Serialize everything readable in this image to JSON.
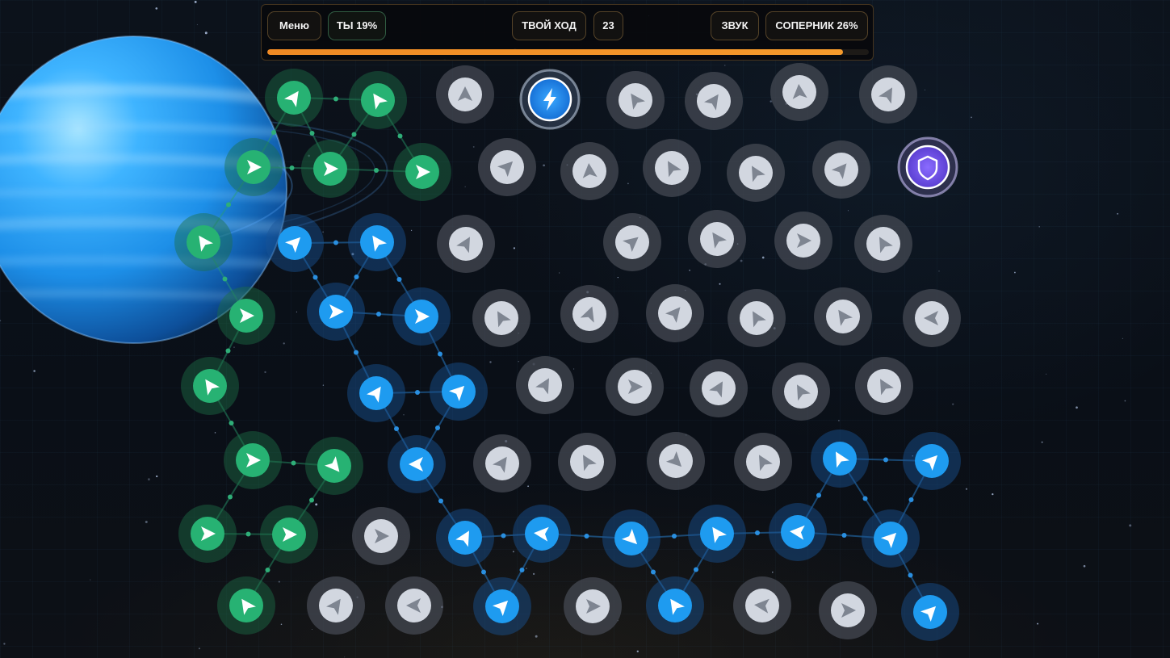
{
  "hud": {
    "menu_label": "Меню",
    "you_label": "ТЫ 19%",
    "you_share": 0.19,
    "turn_label": "ТВОЙ ХОД",
    "turn_counter": "23",
    "sound_label": "ЗВУК",
    "opponent_label": "СОПЕРНИК 26%",
    "opponent_share": 0.26,
    "progress": 0.957
  },
  "colors": {
    "player_green": "#27b273",
    "ally_blue": "#1e9bf0",
    "neutral_gray": "#d2d7e0",
    "progress_orange": "#f08a24",
    "powerup_blue": "#1c8ef2",
    "shield_purple": "#7b5cf0"
  },
  "board": {
    "nodes": [
      {
        "id": "n1",
        "type": "green",
        "dir": 305
      },
      {
        "id": "n2",
        "type": "green",
        "dir": 235
      },
      {
        "id": "n3",
        "type": "neutral",
        "dir": 270
      },
      {
        "id": "n4",
        "type": "powerup",
        "icon": "lightning-icon"
      },
      {
        "id": "n5",
        "type": "neutral",
        "dir": 235
      },
      {
        "id": "n6",
        "type": "neutral",
        "dir": 305
      },
      {
        "id": "n7",
        "type": "neutral",
        "dir": 265
      },
      {
        "id": "n8",
        "type": "neutral",
        "dir": 300
      },
      {
        "id": "n9",
        "type": "green",
        "dir": 0
      },
      {
        "id": "n10",
        "type": "green",
        "dir": 0
      },
      {
        "id": "n11",
        "type": "green",
        "dir": 0
      },
      {
        "id": "n12",
        "type": "neutral",
        "dir": 315
      },
      {
        "id": "n13",
        "type": "neutral",
        "dir": 265
      },
      {
        "id": "n14",
        "type": "neutral",
        "dir": 240
      },
      {
        "id": "n15",
        "type": "neutral",
        "dir": 240
      },
      {
        "id": "n16",
        "type": "neutral",
        "dir": 310
      },
      {
        "id": "n17",
        "type": "shield",
        "icon": "shield-icon"
      },
      {
        "id": "n18",
        "type": "green",
        "dir": 235
      },
      {
        "id": "n19",
        "type": "blue",
        "dir": 315
      },
      {
        "id": "n20",
        "type": "blue",
        "dir": 235
      },
      {
        "id": "n21",
        "type": "neutral",
        "dir": 300
      },
      {
        "id": "n22",
        "type": "neutral",
        "dir": 320
      },
      {
        "id": "n23",
        "type": "neutral",
        "dir": 235
      },
      {
        "id": "n24",
        "type": "neutral",
        "dir": 0
      },
      {
        "id": "n25",
        "type": "neutral",
        "dir": 240
      },
      {
        "id": "n26",
        "type": "green",
        "dir": 0
      },
      {
        "id": "n27",
        "type": "blue",
        "dir": 0
      },
      {
        "id": "n28",
        "type": "blue",
        "dir": 0
      },
      {
        "id": "n29",
        "type": "neutral",
        "dir": 240
      },
      {
        "id": "n30",
        "type": "neutral",
        "dir": 290
      },
      {
        "id": "n31",
        "type": "neutral",
        "dir": 310
      },
      {
        "id": "n32",
        "type": "neutral",
        "dir": 240
      },
      {
        "id": "n33",
        "type": "neutral",
        "dir": 235
      },
      {
        "id": "n34",
        "type": "neutral",
        "dir": 180
      },
      {
        "id": "n35",
        "type": "green",
        "dir": 235
      },
      {
        "id": "n36",
        "type": "blue",
        "dir": 305
      },
      {
        "id": "n37",
        "type": "blue",
        "dir": 315
      },
      {
        "id": "n38",
        "type": "neutral",
        "dir": 300
      },
      {
        "id": "n39",
        "type": "neutral",
        "dir": 0
      },
      {
        "id": "n40",
        "type": "neutral",
        "dir": 300
      },
      {
        "id": "n41",
        "type": "neutral",
        "dir": 240
      },
      {
        "id": "n42",
        "type": "neutral",
        "dir": 240
      },
      {
        "id": "n43",
        "type": "green",
        "dir": 0
      },
      {
        "id": "n44",
        "type": "green",
        "dir": 50
      },
      {
        "id": "n45",
        "type": "blue",
        "dir": 180
      },
      {
        "id": "n46",
        "type": "neutral",
        "dir": 305
      },
      {
        "id": "n47",
        "type": "neutral",
        "dir": 240
      },
      {
        "id": "n48",
        "type": "neutral",
        "dir": 45
      },
      {
        "id": "n49",
        "type": "neutral",
        "dir": 240
      },
      {
        "id": "n50",
        "type": "blue",
        "dir": 240
      },
      {
        "id": "n51",
        "type": "blue",
        "dir": 315
      },
      {
        "id": "n52",
        "type": "green",
        "dir": 0
      },
      {
        "id": "n53",
        "type": "green",
        "dir": 0
      },
      {
        "id": "n54",
        "type": "neutral",
        "dir": 0
      },
      {
        "id": "n55",
        "type": "blue",
        "dir": 300
      },
      {
        "id": "n56",
        "type": "blue",
        "dir": 185
      },
      {
        "id": "n57",
        "type": "blue",
        "dir": 45
      },
      {
        "id": "n58",
        "type": "blue",
        "dir": 235
      },
      {
        "id": "n59",
        "type": "blue",
        "dir": 185
      },
      {
        "id": "n60",
        "type": "blue",
        "dir": 315
      },
      {
        "id": "n61",
        "type": "green",
        "dir": 235
      },
      {
        "id": "n62",
        "type": "neutral",
        "dir": 305
      },
      {
        "id": "n63",
        "type": "neutral",
        "dir": 180
      },
      {
        "id": "n64",
        "type": "blue",
        "dir": 315
      },
      {
        "id": "n65",
        "type": "neutral",
        "dir": 0
      },
      {
        "id": "n66",
        "type": "blue",
        "dir": 235
      },
      {
        "id": "n67",
        "type": "neutral",
        "dir": 185
      },
      {
        "id": "n68",
        "type": "neutral",
        "dir": 0
      },
      {
        "id": "n69",
        "type": "blue",
        "dir": 315
      }
    ],
    "links": [
      [
        "n1",
        "n2"
      ],
      [
        "n1",
        "n9"
      ],
      [
        "n1",
        "n10"
      ],
      [
        "n2",
        "n10"
      ],
      [
        "n2",
        "n11"
      ],
      [
        "n9",
        "n10"
      ],
      [
        "n10",
        "n11"
      ],
      [
        "n9",
        "n18"
      ],
      [
        "n18",
        "n26"
      ],
      [
        "n26",
        "n35"
      ],
      [
        "n35",
        "n43"
      ],
      [
        "n43",
        "n44"
      ],
      [
        "n43",
        "n52"
      ],
      [
        "n44",
        "n53"
      ],
      [
        "n52",
        "n53"
      ],
      [
        "n53",
        "n61"
      ],
      [
        "n19",
        "n20"
      ],
      [
        "n19",
        "n27"
      ],
      [
        "n20",
        "n28"
      ],
      [
        "n20",
        "n27"
      ],
      [
        "n27",
        "n28"
      ],
      [
        "n27",
        "n36"
      ],
      [
        "n28",
        "n37"
      ],
      [
        "n36",
        "n37"
      ],
      [
        "n36",
        "n45"
      ],
      [
        "n37",
        "n45"
      ],
      [
        "n45",
        "n55"
      ],
      [
        "n55",
        "n56"
      ],
      [
        "n55",
        "n64"
      ],
      [
        "n56",
        "n64"
      ],
      [
        "n56",
        "n57"
      ],
      [
        "n57",
        "n58"
      ],
      [
        "n57",
        "n66"
      ],
      [
        "n58",
        "n66"
      ],
      [
        "n58",
        "n59"
      ],
      [
        "n59",
        "n60"
      ],
      [
        "n59",
        "n50"
      ],
      [
        "n50",
        "n51"
      ],
      [
        "n50",
        "n60"
      ],
      [
        "n51",
        "n60"
      ],
      [
        "n60",
        "n69"
      ]
    ]
  }
}
